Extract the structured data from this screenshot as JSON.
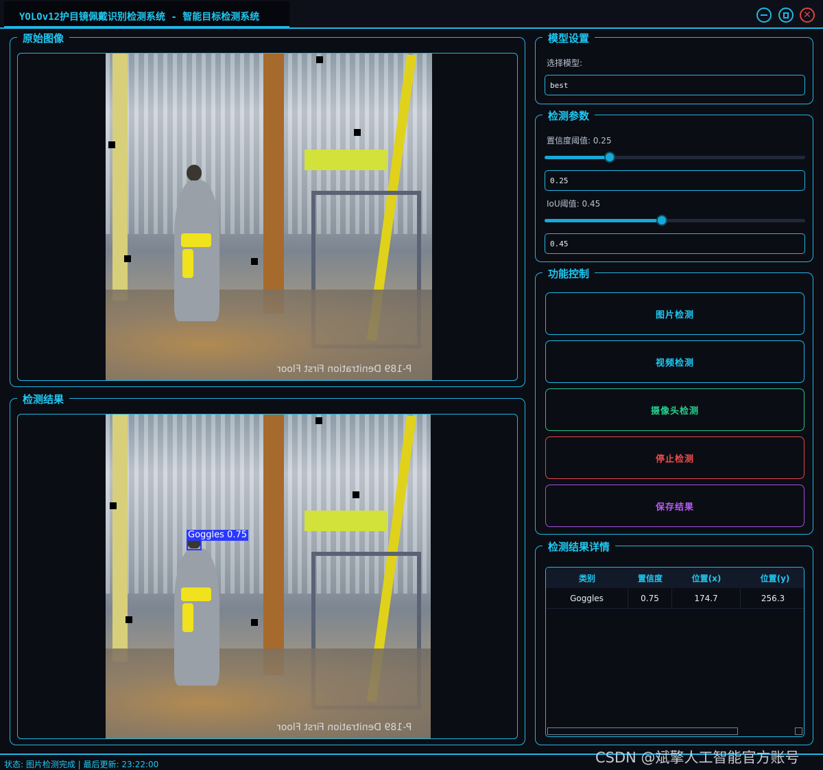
{
  "window": {
    "title": "YOLOv12护目镜佩戴识别检测系统 - 智能目标检测系统"
  },
  "panels": {
    "original_title": "原始图像",
    "result_title": "检测结果"
  },
  "image": {
    "mirror_text": "P-189 Denitration First Floor"
  },
  "detection": {
    "label": "Goggles 0.75"
  },
  "model_settings": {
    "title": "模型设置",
    "select_label": "选择模型:",
    "selected_model": "best"
  },
  "detection_params": {
    "title": "检测参数",
    "confidence_label": "置信度阈值: 0.25",
    "confidence_value": "0.25",
    "confidence_level": 0.25,
    "iou_label": "IoU阈值: 0.45",
    "iou_value": "0.45",
    "iou_level": 0.45
  },
  "controls": {
    "title": "功能控制",
    "image_detect": "图片检测",
    "video_detect": "视频检测",
    "camera_detect": "摄像头检测",
    "stop_detect": "停止检测",
    "save_result": "保存结果",
    "colors": {
      "image": "#1fb8e6",
      "video": "#1fb8e6",
      "camera": "#25c48a",
      "stop": "#e04848",
      "save": "#a64ee0"
    }
  },
  "results": {
    "title": "检测结果详情",
    "headers": [
      "类别",
      "置信度",
      "位置(x)",
      "位置(y)"
    ],
    "rows": [
      [
        "Goggles",
        "0.75",
        "174.7",
        "256.3"
      ]
    ]
  },
  "status": {
    "text": "状态: 图片检测完成 | 最后更新: 23:22:00"
  },
  "watermark": "CSDN @斌擎人工智能官方账号"
}
